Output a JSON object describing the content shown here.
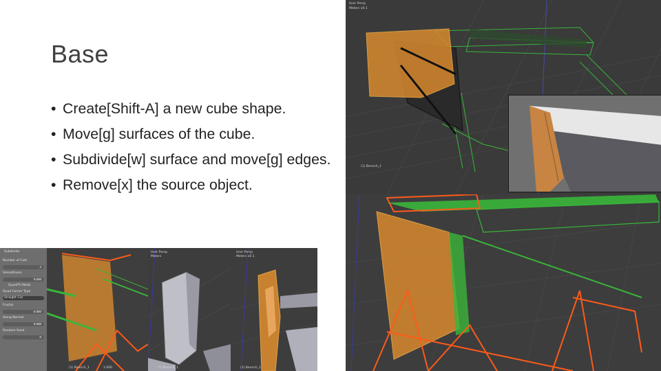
{
  "slide": {
    "title": "Base",
    "bullets": [
      {
        "text": "Create[Shift-A] a new cube shape."
      },
      {
        "text": "Move[g] surfaces of  the cube."
      },
      {
        "text": "Subdivide[w] surface and move[g] edges."
      },
      {
        "text": "Remove[x] the source object."
      }
    ]
  },
  "screenshots": {
    "top_view": {
      "header_line1": "User Persp",
      "header_line2": "Meters x0.1",
      "object_label": "(1) Bennch_1"
    },
    "subdivide_panel": {
      "title": "Subdivide",
      "rows": [
        {
          "label": "Number of Cuts",
          "value": "4"
        },
        {
          "label": "Smoothness",
          "value": "0.000"
        },
        {
          "label": "Quad/Tri Mode",
          "value": ""
        },
        {
          "label": "Quad Corner Type",
          "value": ""
        },
        {
          "label": "Straight Cut",
          "value": ""
        },
        {
          "label": "Fractal",
          "value": "0.000"
        },
        {
          "label": "Along Normal",
          "value": "0.000"
        },
        {
          "label": "Random Seed",
          "value": "0"
        }
      ],
      "footer_label": "(1) Bennch_1",
      "footer_value": "1.000"
    },
    "middle_view": {
      "header_line1": "User Persp",
      "header_line2": "Meters",
      "footer": "(1) Bennch_1"
    },
    "right_view": {
      "header_line1": "User Persp",
      "header_line2": "Meters x0.1",
      "footer": "(1) Bennch_1"
    }
  },
  "colors": {
    "viewport_bg": "#3b3b3b",
    "grid": "#474747",
    "selected_face": "#d7892e",
    "wire_green": "#39b53a",
    "wire_orange": "#ff5a1a"
  }
}
